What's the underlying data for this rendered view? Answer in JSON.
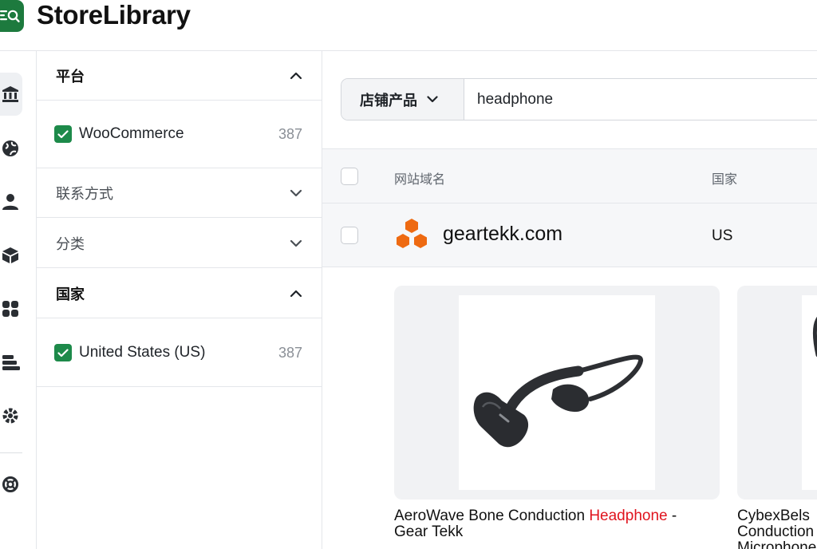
{
  "app": {
    "title": "StoreLibrary"
  },
  "filters": {
    "platform": {
      "title": "平台",
      "option_label": "WooCommerce",
      "option_count": "387"
    },
    "contact": {
      "title": "联系方式"
    },
    "category": {
      "title": "分类"
    },
    "country": {
      "title": "国家",
      "option_label": "United States (US)",
      "option_count": "387"
    }
  },
  "search": {
    "scope": "店铺产品",
    "query": "headphone"
  },
  "table": {
    "headers": {
      "domain": "网站域名",
      "country": "国家"
    },
    "rows": [
      {
        "domain": "geartekk.com",
        "country": "US"
      }
    ]
  },
  "products": [
    {
      "title_prefix": "AeroWave Bone Conduction ",
      "title_highlight": "Headphone",
      "title_suffix": " - Gear Tekk"
    },
    {
      "title_prefix": "CybexBels",
      "title_line2": "Conduction",
      "title_line3": "Microphone"
    }
  ],
  "colors": {
    "brand_green": "#1d7a3e",
    "checkbox_green": "#1d8a4a",
    "highlight_red": "#e0141e",
    "domain_logo_orange": "#ee6a12"
  },
  "icons": [
    "store-library-logo-icon",
    "bank-icon",
    "globe-icon",
    "user-icon",
    "box-icon",
    "apps-icon",
    "stack-icon",
    "gear-icon",
    "support-icon",
    "chevron-up-icon",
    "chevron-down-icon",
    "check-icon"
  ]
}
